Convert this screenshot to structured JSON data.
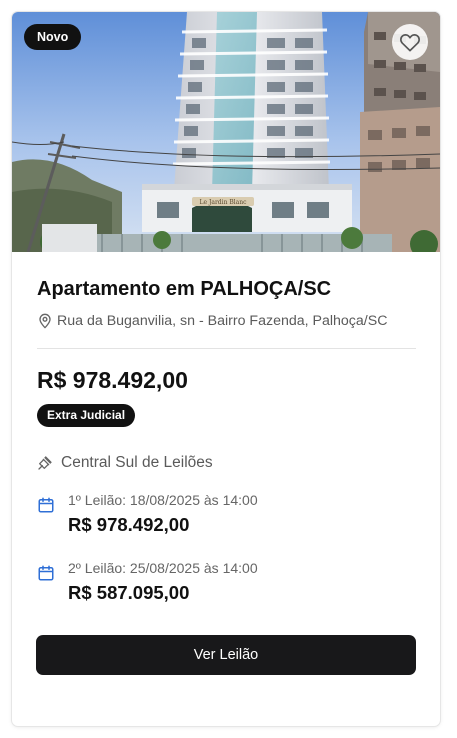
{
  "listing": {
    "badge": "Novo",
    "favorite_icon": "heart-outline-icon",
    "title": "Apartamento em PALHOÇA/SC",
    "address_icon": "map-pin-icon",
    "address": "Rua da Buganvilia, sn - Bairro Fazenda, Palhoça/SC",
    "price": "R$ 978.492,00",
    "sale_type": "Extra Judicial",
    "auctioneer_icon": "gavel-icon",
    "auctioneer": "Central Sul de Leilões",
    "rounds": [
      {
        "icon": "calendar-icon",
        "label": "1º Leilão: 18/08/2025 às 14:00",
        "value": "R$ 978.492,00"
      },
      {
        "icon": "calendar-icon",
        "label": "2º Leilão: 25/08/2025 às 14:00",
        "value": "R$ 587.095,00"
      }
    ],
    "cta_label": "Ver Leilão",
    "building_sign": "Le Jardin Blanc"
  },
  "colors": {
    "primary": "#18181a",
    "accent_blue": "#2f6fd6",
    "muted_text": "#5a5a5a",
    "divider": "#e3e3e3"
  }
}
